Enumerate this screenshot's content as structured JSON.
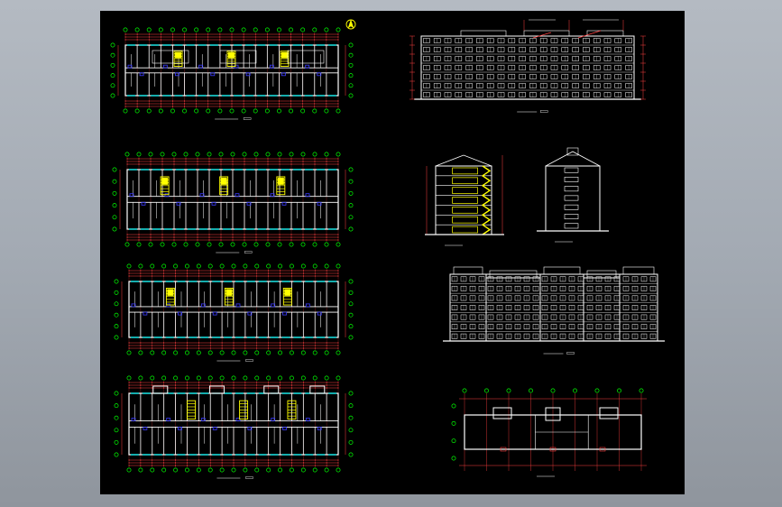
{
  "window": {
    "background": "#a7adb5",
    "drawing_background": "#000000"
  },
  "drawing": {
    "title": "",
    "colors": {
      "wall": "#ffffff",
      "dimension": "#ff4040",
      "axis_bubble": "#00ff00",
      "stair": "#ffff00",
      "door": "#3a3aff",
      "window": "#00ffff"
    },
    "sheets": [
      {
        "name": "roof-plan",
        "caption": ""
      },
      {
        "name": "standard-floor-plan",
        "caption": ""
      },
      {
        "name": "second-floor-plan",
        "caption": ""
      },
      {
        "name": "ground-floor-plan",
        "caption": ""
      },
      {
        "name": "rear-elevation",
        "caption": ""
      },
      {
        "name": "section",
        "caption": ""
      },
      {
        "name": "side-elevation",
        "caption": ""
      },
      {
        "name": "front-elevation",
        "caption": ""
      },
      {
        "name": "site-plan",
        "caption": ""
      }
    ],
    "north_arrow": "north-arrow-icon"
  }
}
